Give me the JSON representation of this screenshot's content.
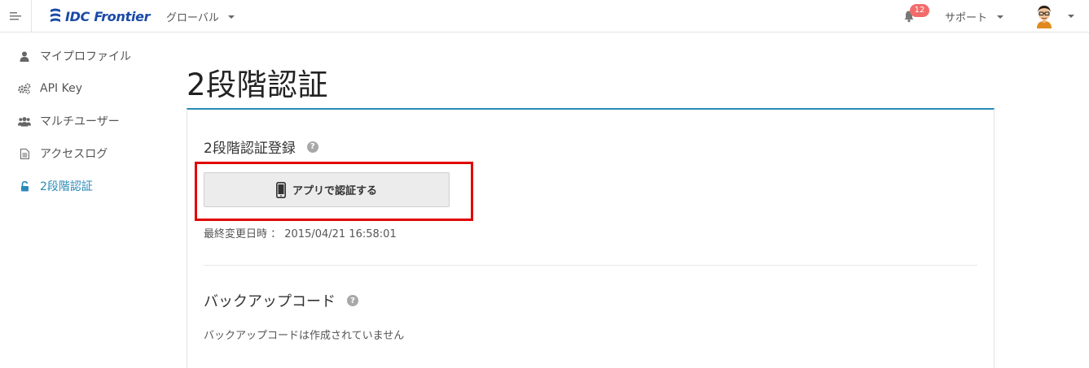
{
  "header": {
    "logo_text": "IDC Frontier",
    "region_label": "グローバル",
    "notification_count": "12",
    "support_label": "サポート"
  },
  "sidebar": {
    "items": [
      {
        "label": "マイプロファイル",
        "icon": "user-icon",
        "active": false
      },
      {
        "label": "API Key",
        "icon": "gears-icon",
        "active": false
      },
      {
        "label": "マルチユーザー",
        "icon": "users-icon",
        "active": false
      },
      {
        "label": "アクセスログ",
        "icon": "document-icon",
        "active": false
      },
      {
        "label": "2段階認証",
        "icon": "unlock-icon",
        "active": true
      }
    ]
  },
  "main": {
    "page_title": "2段階認証",
    "registration": {
      "title": "2段階認証登録",
      "button_label": "アプリで認証する",
      "last_modified": "最終変更日時 ： 2015/04/21 16:58:01"
    },
    "backup": {
      "title": "バックアップコード",
      "status_text": "バックアップコードは作成されていません"
    }
  },
  "colors": {
    "accent": "#2a8ab8",
    "highlight": "#e10000",
    "badge": "#f26b6b",
    "logo": "#1a4aa6"
  }
}
